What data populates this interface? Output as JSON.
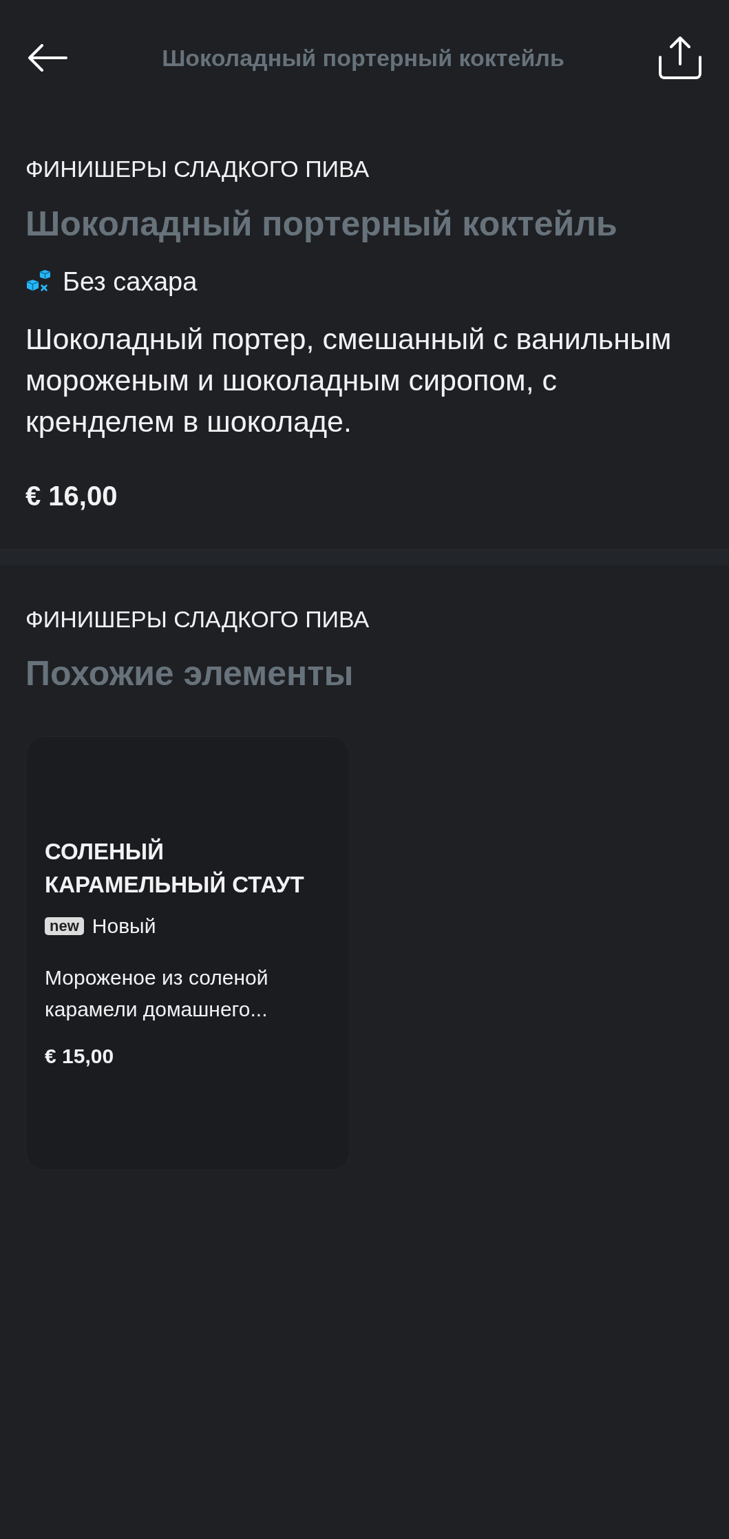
{
  "top_bar": {
    "title": "Шоколадный портерный коктейль"
  },
  "product": {
    "category": "ФИНИШЕРЫ СЛАДКОГО ПИВА",
    "title": "Шоколадный портерный коктейль",
    "tags": [
      {
        "kind": "sugar_free",
        "label": "Без сахара"
      }
    ],
    "description": "Шоколадный портер, смешанный с ванильным мороженым и шоколадным сиропом, с кренделем в шоколаде.",
    "price": "€ 16,00"
  },
  "similar": {
    "category": "ФИНИШЕРЫ СЛАДКОГО ПИВА",
    "title": "Похожие элементы",
    "items": [
      {
        "name": "СОЛЕНЫЙ КАРАМЕЛЬНЫЙ СТАУТ",
        "tags": [
          {
            "kind": "badge",
            "badge": "new",
            "label": "Новый"
          }
        ],
        "description": "Мороженое из соленой карамели домашнего...",
        "price": "€ 15,00"
      }
    ]
  }
}
